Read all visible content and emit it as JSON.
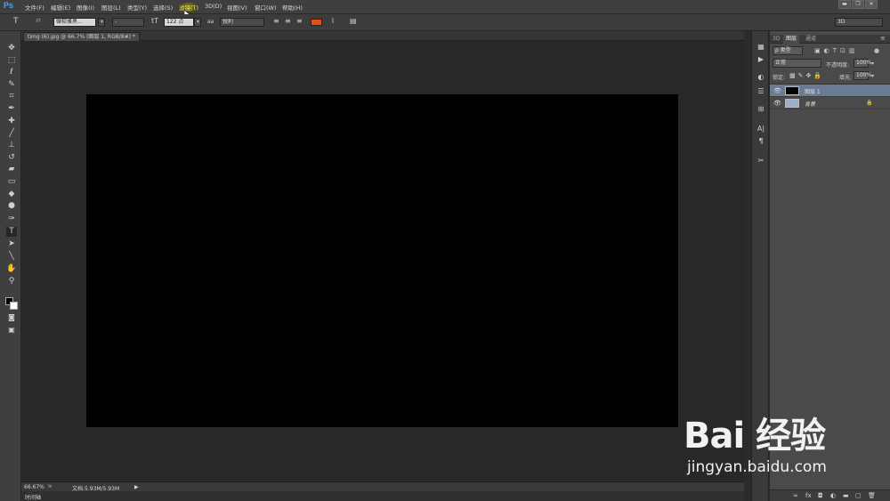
{
  "app": {
    "logo": "Ps"
  },
  "menubar": {
    "items": [
      "文件(F)",
      "编辑(E)",
      "图像(I)",
      "图层(L)",
      "类型(Y)",
      "选择(S)",
      "滤镜(T)",
      "3D(D)",
      "视图(V)",
      "窗口(W)",
      "帮助(H)"
    ],
    "active_item": "滤镜(T)"
  },
  "window_controls": {
    "minimize": "▬",
    "restore": "❐",
    "close": "✕"
  },
  "options_bar": {
    "tool_icon": "T",
    "font_family": "微软雅黑...",
    "font_style": "-",
    "font_size": "122 点",
    "antialias_icon": "aa",
    "antialias": "锐利",
    "text_color": "#e8501a",
    "workspace": "3D"
  },
  "document": {
    "tab_title": "timg (6).jpg @ 66.7% (图层 1, RGB/8#) *",
    "canvas_color": "#000000"
  },
  "statusbar": {
    "zoom": "66.67%",
    "doc_info": "文档:5.93M/5.93M",
    "arrow": "▶"
  },
  "timeline": {
    "label": "时间轴"
  },
  "layers_panel": {
    "tabs": [
      "3D",
      "图层",
      "通道"
    ],
    "active_tab": "图层",
    "filter_label": "ρ 类型",
    "blend_mode": "正常",
    "opacity_label": "不透明度:",
    "opacity": "100%",
    "lock_label": "锁定:",
    "fill_label": "填充:",
    "fill": "100%",
    "layers": [
      {
        "name": "图层 1",
        "selected": true,
        "thumb": "#000000"
      },
      {
        "name": "背景",
        "selected": false,
        "thumb": "#9ab0c8"
      }
    ]
  },
  "watermark": {
    "logo": "Bai 经验",
    "url": "jingyan.baidu.com"
  }
}
